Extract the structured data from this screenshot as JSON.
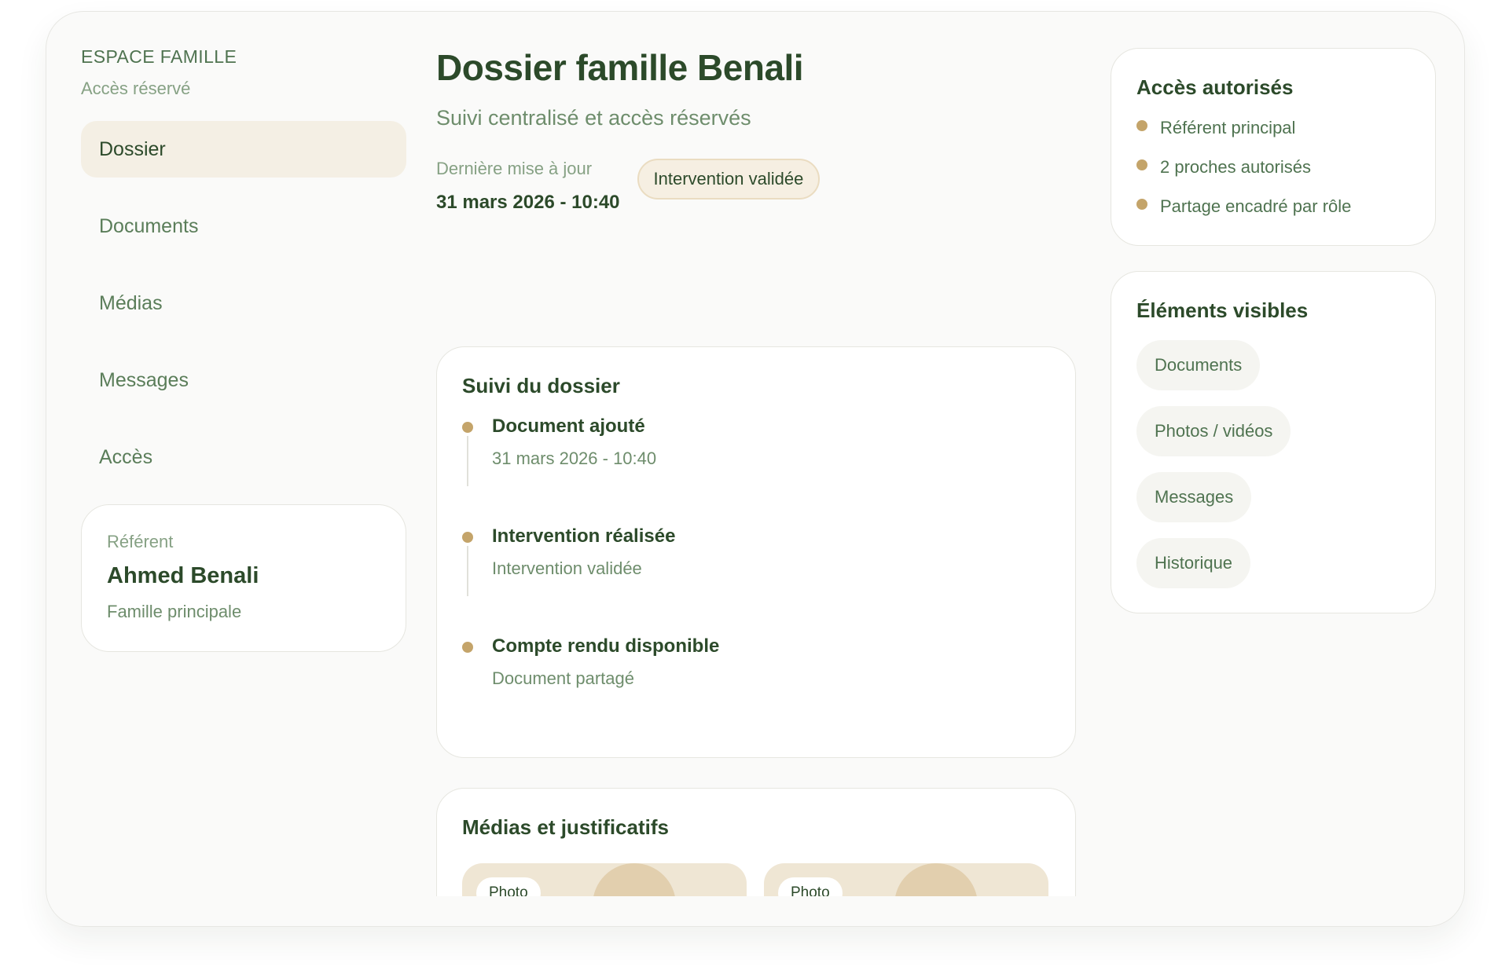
{
  "sidebar": {
    "brand": "ESPACE FAMILLE",
    "brand_sub": "Accès réservé",
    "items": [
      {
        "label": "Dossier",
        "active": true
      },
      {
        "label": "Documents"
      },
      {
        "label": "Médias"
      },
      {
        "label": "Messages"
      },
      {
        "label": "Accès"
      }
    ],
    "referent": {
      "label": "Référent",
      "name": "Ahmed Benali",
      "role": "Famille principale"
    }
  },
  "main": {
    "title": "Dossier famille Benali",
    "subtitle": "Suivi centralisé et accès réservés",
    "updated_label": "Dernière mise à jour",
    "updated_value": "31 mars 2026 - 10:40",
    "status_badge": "Intervention validée",
    "timeline": {
      "title": "Suivi du dossier",
      "items": [
        {
          "title": "Document ajouté",
          "sub": "31 mars 2026 - 10:40"
        },
        {
          "title": "Intervention réalisée",
          "sub": "Intervention validée"
        },
        {
          "title": "Compte rendu disponible",
          "sub": "Document partagé"
        }
      ]
    },
    "media": {
      "title": "Médias et justificatifs",
      "tiles": [
        {
          "tag": "Photo"
        },
        {
          "tag": "Photo"
        }
      ]
    }
  },
  "right": {
    "access": {
      "title": "Accès autorisés",
      "items": [
        "Référent principal",
        "2 proches autorisés",
        "Partage encadré par rôle"
      ]
    },
    "visible": {
      "title": "Éléments visibles",
      "chips": [
        "Documents",
        "Photos / vidéos",
        "Messages",
        "Historique"
      ]
    }
  },
  "colors": {
    "accent_dot": "#c4a46a",
    "text_dark": "#2c4a2a",
    "text_muted": "#6e8d6c",
    "nav_active_bg": "#f4efe4"
  }
}
